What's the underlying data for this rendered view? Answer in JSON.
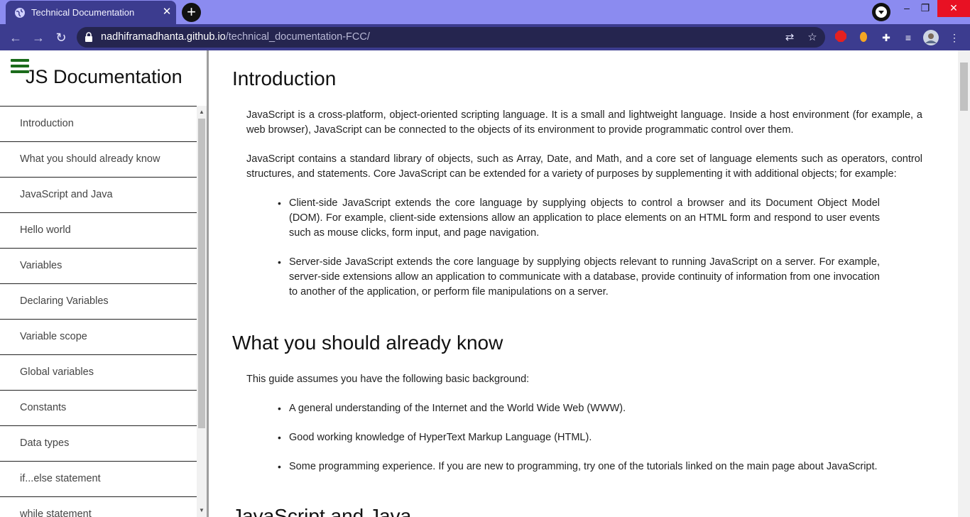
{
  "browser": {
    "tab_title": "Technical Documentation",
    "tab_close": "✕",
    "new_tab": "+",
    "url_host": "nadhiframadhanta.github.io",
    "url_path": "/technical_documentation-FCC/",
    "window_controls": {
      "minimize": "–",
      "restore": "❐",
      "close": "✕"
    }
  },
  "sidebar": {
    "title": "JS Documentation",
    "items": [
      "Introduction",
      "What you should already know",
      "JavaScript and Java",
      "Hello world",
      "Variables",
      "Declaring Variables",
      "Variable scope",
      "Global variables",
      "Constants",
      "Data types",
      "if...else statement",
      "while statement"
    ]
  },
  "main": {
    "intro": {
      "heading": "Introduction",
      "p1": "JavaScript is a cross-platform, object-oriented scripting language. It is a small and lightweight language. Inside a host environment (for example, a web browser), JavaScript can be connected to the objects of its environment to provide programmatic control over them.",
      "p2": "JavaScript contains a standard library of objects, such as Array, Date, and Math, and a core set of language elements such as operators, control structures, and statements. Core JavaScript can be extended for a variety of purposes by supplementing it with additional objects; for example:",
      "li1": "Client-side JavaScript extends the core language by supplying objects to control a browser and its Document Object Model (DOM). For example, client-side extensions allow an application to place elements on an HTML form and respond to user events such as mouse clicks, form input, and page navigation.",
      "li2": "Server-side JavaScript extends the core language by supplying objects relevant to running JavaScript on a server. For example, server-side extensions allow an application to communicate with a database, provide continuity of information from one invocation to another of the application, or perform file manipulations on a server."
    },
    "know": {
      "heading": "What you should already know",
      "p1": "This guide assumes you have the following basic background:",
      "li1": "A general understanding of the Internet and the World Wide Web (WWW).",
      "li2": "Good working knowledge of HyperText Markup Language (HTML).",
      "li3": "Some programming experience. If you are new to programming, try one of the tutorials linked on the main page about JavaScript."
    },
    "java": {
      "heading": "JavaScript and Java"
    }
  }
}
